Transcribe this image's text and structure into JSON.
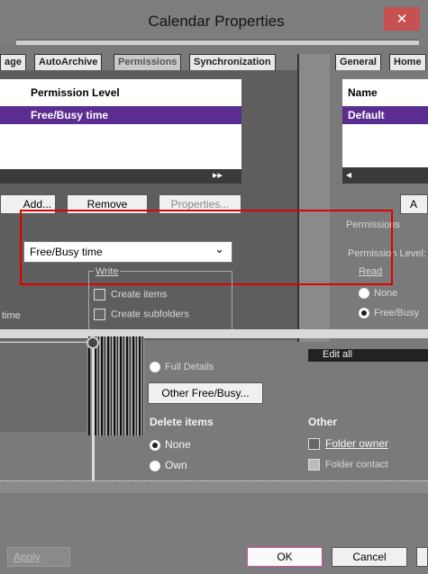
{
  "window": {
    "title": "Calendar Properties",
    "close_glyph": "✕"
  },
  "tabs_left": [
    "age",
    "AutoArchive",
    "Permissions",
    "Synchronization"
  ],
  "tabs_right": [
    "General",
    "Home"
  ],
  "left_list": {
    "column_header": "Permission Level",
    "selected_row": "Free/Busy time",
    "scroll_glyph": "▸▸"
  },
  "right_list": {
    "column_header": "Name",
    "selected_row": "Default",
    "scroll_glyph": "◂"
  },
  "buttons": {
    "add": "Add...",
    "remove": "Remove",
    "properties": "Properties...",
    "add_right": "A",
    "other_free_busy": "Other Free/Busy...",
    "apply": "Apply",
    "ok": "OK",
    "cancel": "Cancel"
  },
  "permission_combo": {
    "value": "Free/Busy time",
    "arrow": "⌄"
  },
  "permissions_right": {
    "group_label": "Permissions",
    "level_label": "Permission Level:"
  },
  "read_group": {
    "label": "Read",
    "none": "None",
    "free_busy": "Free/Busy"
  },
  "write_group": {
    "label": "Write",
    "create_items": "Create items",
    "create_subfolders": "Create subfolders",
    "left_fragment": "time"
  },
  "read_options": {
    "full_details": "Full Details"
  },
  "edit_label": "Edit all",
  "delete_items": {
    "label": "Delete items",
    "none": "None",
    "own": "Own"
  },
  "other": {
    "label": "Other",
    "folder_owner": "Folder owner",
    "folder_contact": "Folder contact"
  },
  "colors": {
    "accent": "#5b2d91",
    "highlight": "#e00000",
    "close": "#c75050"
  }
}
